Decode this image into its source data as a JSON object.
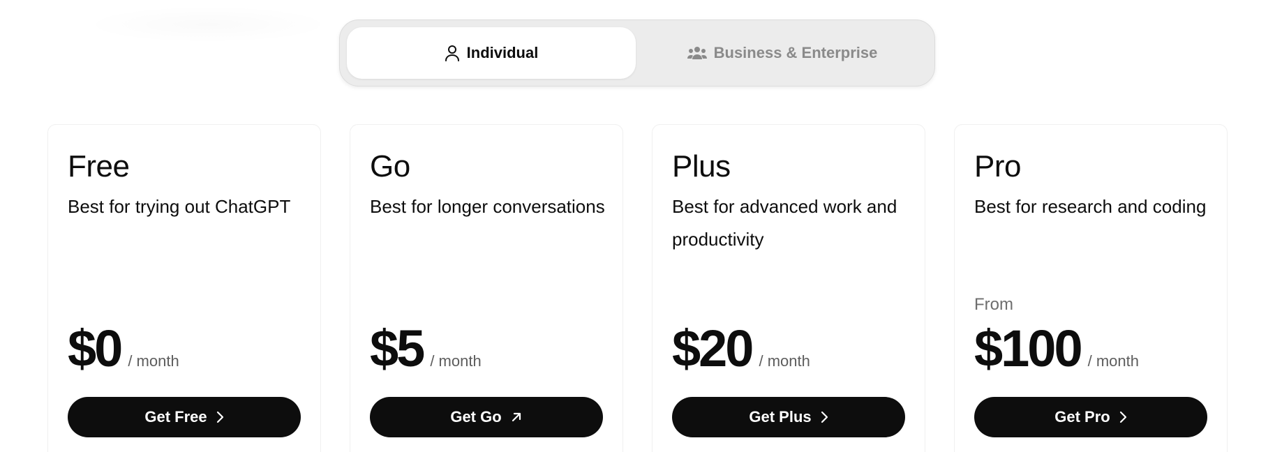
{
  "toggle": {
    "individual": {
      "label": "Individual",
      "icon": "person-icon",
      "selected": true
    },
    "business": {
      "label": "Business & Enterprise",
      "icon": "people-group-icon",
      "selected": false
    }
  },
  "plans": [
    {
      "name": "Free",
      "description": "Best for trying out ChatGPT",
      "price_prefix": "",
      "price": "$0",
      "period": "/ month",
      "cta_label": "Get Free",
      "cta_icon": "chevron-right-icon"
    },
    {
      "name": "Go",
      "description": "Best for longer conversations",
      "price_prefix": "",
      "price": "$5",
      "period": "/ month",
      "cta_label": "Get Go",
      "cta_icon": "arrow-up-right-icon"
    },
    {
      "name": "Plus",
      "description": "Best for advanced work and productivity",
      "price_prefix": "",
      "price": "$20",
      "period": "/ month",
      "cta_label": "Get Plus",
      "cta_icon": "chevron-right-icon"
    },
    {
      "name": "Pro",
      "description": "Best for research and coding",
      "price_prefix": "From",
      "price": "$100",
      "period": "/ month",
      "cta_label": "Get Pro",
      "cta_icon": "chevron-right-icon"
    }
  ],
  "colors": {
    "button_bg": "#0d0d0d",
    "toggle_bg": "#ececec",
    "inactive_text": "#8a8a8a"
  }
}
